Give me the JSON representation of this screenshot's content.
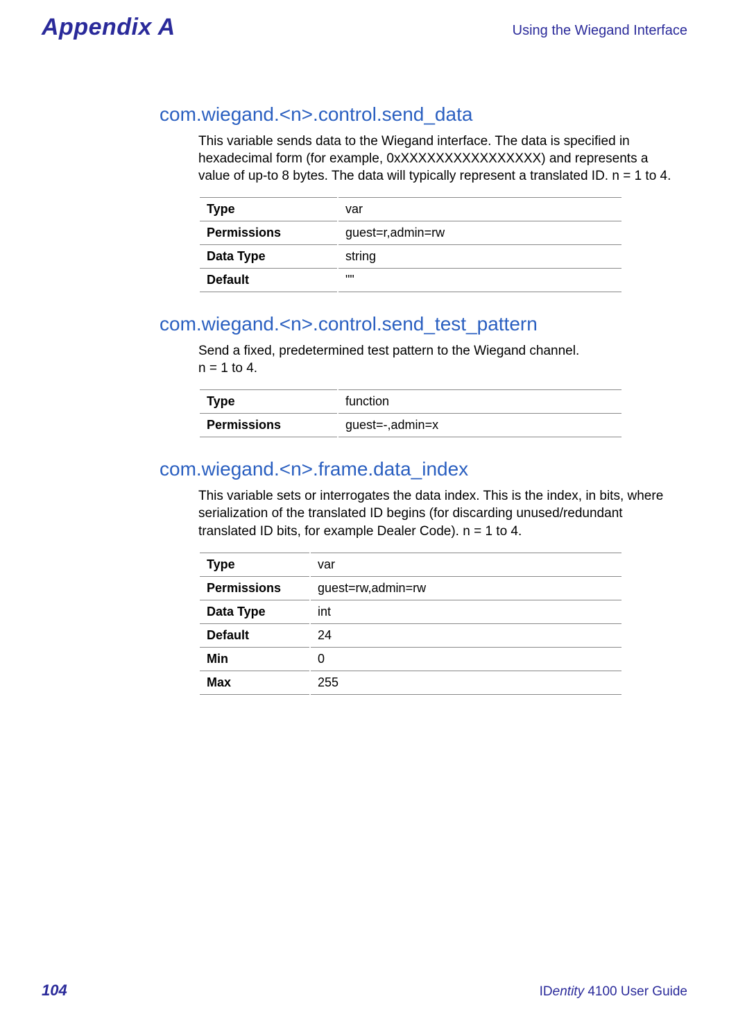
{
  "header": {
    "appendix": "Appendix A",
    "right": "Using the Wiegand Interface"
  },
  "sections": [
    {
      "heading": "com.wiegand.<n>.control.send_data",
      "paragraphs": [
        "This variable sends data to the Wiegand interface. The data is specified in hexadecimal form (for example, 0xXXXXXXXXXXXXXXXX) and represents a value of up-to 8 bytes. The data will typically represent a translated ID. n = 1 to 4."
      ],
      "table": {
        "widthClass": [
          "w-label",
          "w-value"
        ],
        "rows": [
          {
            "label": "Type",
            "value": "var"
          },
          {
            "label": "Permissions",
            "value": "guest=r,admin=rw"
          },
          {
            "label": "Data Type",
            "value": "string"
          },
          {
            "label": "Default",
            "value": "\"\""
          }
        ]
      }
    },
    {
      "heading": "com.wiegand.<n>.control.send_test_pattern",
      "paragraphs": [
        "Send a fixed, predetermined test pattern to the Wiegand channel.",
        "n = 1 to 4."
      ],
      "table": {
        "widthClass": [
          "w-label",
          "w-value"
        ],
        "rows": [
          {
            "label": "Type",
            "value": "function"
          },
          {
            "label": "Permissions",
            "value": "guest=-,admin=x"
          }
        ]
      }
    },
    {
      "heading": "com.wiegand.<n>.frame.data_index",
      "paragraphs": [
        "This variable sets or interrogates the data index. This is the index, in bits, where serialization of the translated ID begins (for discarding unused/redundant translated ID bits, for example Dealer Code). n = 1 to 4."
      ],
      "table": {
        "widthClass": [
          "w-label-s",
          "w-value-s"
        ],
        "rows": [
          {
            "label": "Type",
            "value": "var"
          },
          {
            "label": "Permissions",
            "value": "guest=rw,admin=rw"
          },
          {
            "label": "Data Type",
            "value": "int"
          },
          {
            "label": "Default",
            "value": "24"
          },
          {
            "label": "Min",
            "value": "0"
          },
          {
            "label": "Max",
            "value": "255"
          }
        ]
      }
    }
  ],
  "footer": {
    "page": "104",
    "guide_id": "ID",
    "guide_entity": "entity",
    "guide_rest": " 4100 User Guide"
  }
}
